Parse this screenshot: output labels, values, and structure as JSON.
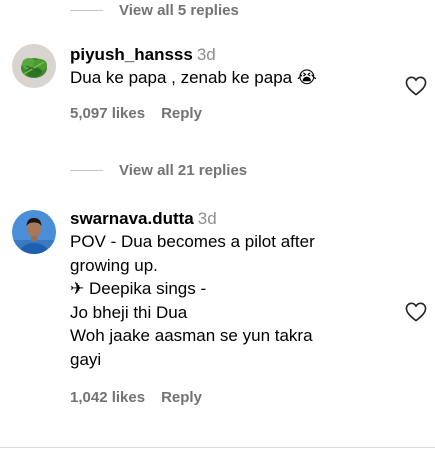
{
  "top_replies": {
    "label": "View all 5 replies"
  },
  "comments": [
    {
      "username": "piyush_hansss",
      "time": "3d",
      "lines": [
        "Dua ke papa , zenab ke papa 😭"
      ],
      "likes": "5,097 likes",
      "reply_label": "Reply",
      "view_replies_label": "View all 21 replies",
      "avatar": "leaf-avatar"
    },
    {
      "username": "swarnava.dutta",
      "time": "3d",
      "lines": [
        "POV - Dua becomes a pilot after",
        "growing up.",
        "✈ Deepika sings -",
        "Jo bheji thi Dua",
        "Woh jaake aasman se yun takra",
        "gayi"
      ],
      "likes": "1,042 likes",
      "reply_label": "Reply",
      "avatar": "person-avatar"
    }
  ],
  "colors": {
    "muted": "#737373",
    "time": "#8e8e8e",
    "line": "#c7c7c7"
  }
}
